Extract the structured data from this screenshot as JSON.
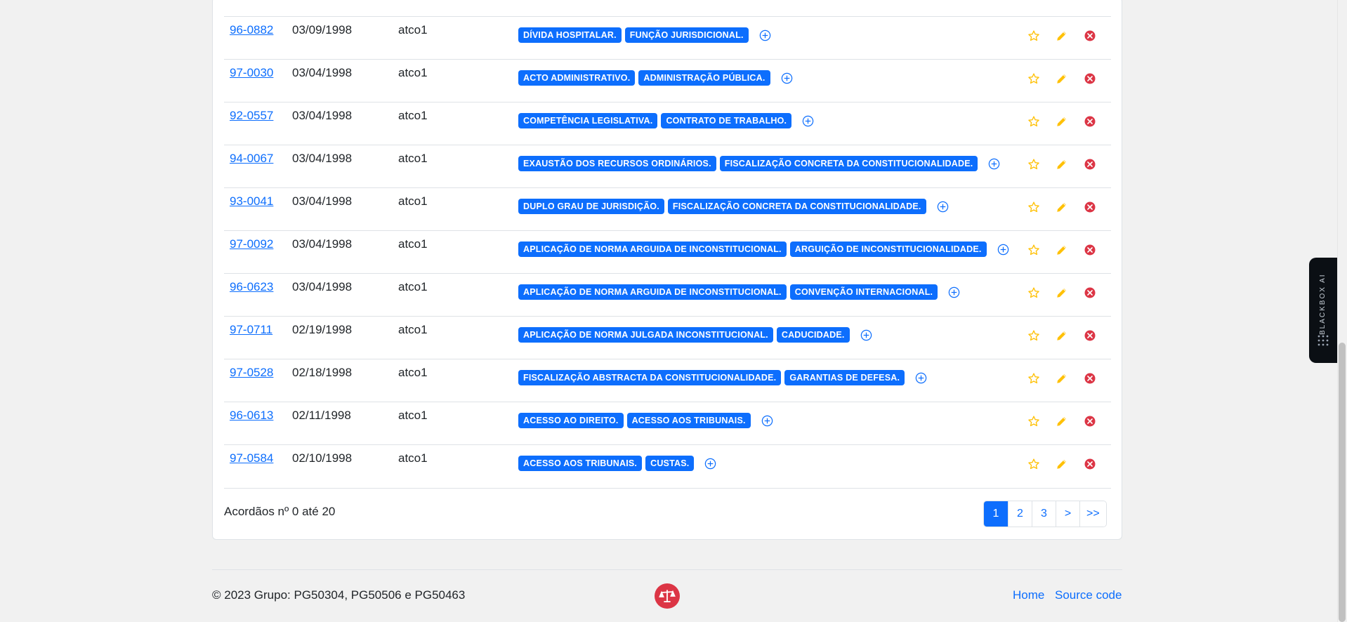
{
  "table": {
    "rows": [
      {
        "id": "96-0882",
        "date": "03/09/1998",
        "user": "atco1",
        "tags": [
          "DÍVIDA HOSPITALAR.",
          "FUNÇÃO JURISDICIONAL."
        ]
      },
      {
        "id": "97-0030",
        "date": "03/04/1998",
        "user": "atco1",
        "tags": [
          "ACTO ADMINISTRATIVO.",
          "ADMINISTRAÇÃO PÚBLICA."
        ]
      },
      {
        "id": "92-0557",
        "date": "03/04/1998",
        "user": "atco1",
        "tags": [
          "COMPETÊNCIA LEGISLATIVA.",
          "CONTRATO DE TRABALHO."
        ]
      },
      {
        "id": "94-0067",
        "date": "03/04/1998",
        "user": "atco1",
        "tags": [
          "EXAUSTÃO DOS RECURSOS ORDINÁRIOS.",
          "FISCALIZAÇÃO CONCRETA DA CONSTITUCIONALIDADE."
        ]
      },
      {
        "id": "93-0041",
        "date": "03/04/1998",
        "user": "atco1",
        "tags": [
          "DUPLO GRAU DE JURISDIÇÃO.",
          "FISCALIZAÇÃO CONCRETA DA CONSTITUCIONALIDADE."
        ]
      },
      {
        "id": "97-0092",
        "date": "03/04/1998",
        "user": "atco1",
        "tags": [
          "APLICAÇÃO DE NORMA ARGUIDA DE INCONSTITUCIONAL.",
          "ARGUIÇÃO DE INCONSTITUCIONALIDADE."
        ]
      },
      {
        "id": "96-0623",
        "date": "03/04/1998",
        "user": "atco1",
        "tags": [
          "APLICAÇÃO DE NORMA ARGUIDA DE INCONSTITUCIONAL.",
          "CONVENÇÃO INTERNACIONAL."
        ]
      },
      {
        "id": "97-0711",
        "date": "02/19/1998",
        "user": "atco1",
        "tags": [
          "APLICAÇÃO DE NORMA JULGADA INCONSTITUCIONAL.",
          "CADUCIDADE."
        ]
      },
      {
        "id": "97-0528",
        "date": "02/18/1998",
        "user": "atco1",
        "tags": [
          "FISCALIZAÇÃO ABSTRACTA DA CONSTITUCIONALIDADE.",
          "GARANTIAS DE DEFESA."
        ]
      },
      {
        "id": "96-0613",
        "date": "02/11/1998",
        "user": "atco1",
        "tags": [
          "ACESSO AO DIREITO.",
          "ACESSO AOS TRIBUNAIS."
        ]
      },
      {
        "id": "97-0584",
        "date": "02/10/1998",
        "user": "atco1",
        "tags": [
          "ACESSO AOS TRIBUNAIS.",
          "CUSTAS."
        ]
      }
    ]
  },
  "summary": "Acordãos nº 0 até 20",
  "pagination": {
    "pages": [
      "1",
      "2",
      "3",
      ">",
      ">>"
    ],
    "active": "1"
  },
  "footer": {
    "copyright": "© 2023 Grupo: PG50304, PG50506 e PG50463",
    "links": [
      "Home",
      "Source code"
    ]
  },
  "sidebar_widget": {
    "label": "BLACKBOX AI"
  },
  "colors": {
    "primary": "#0d6efd",
    "star": "#ffc107",
    "delete": "#dc3545"
  }
}
